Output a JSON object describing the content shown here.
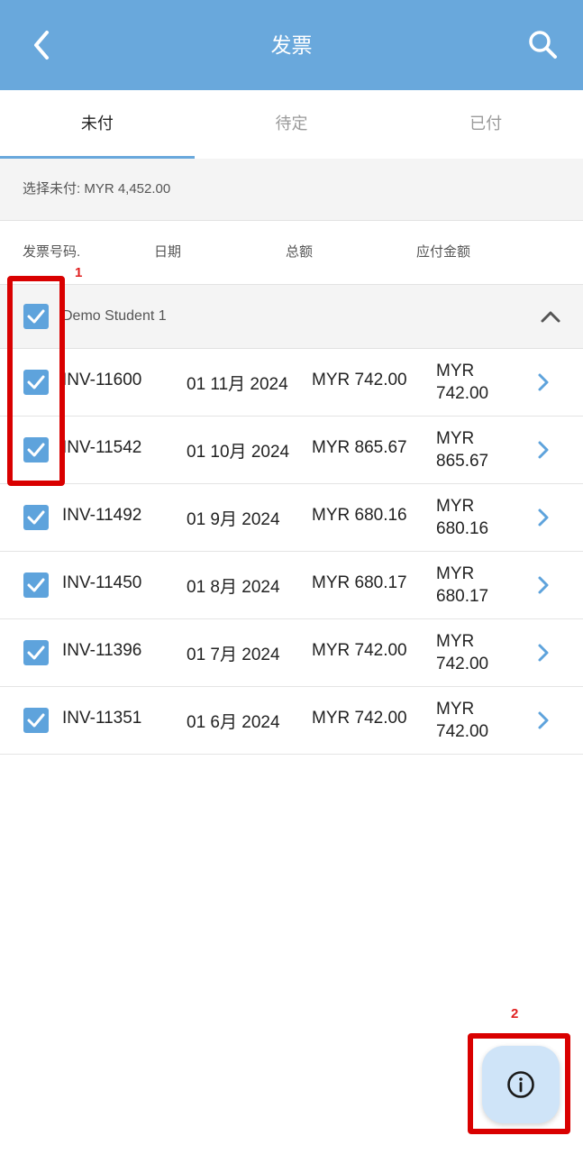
{
  "header": {
    "title": "发票",
    "back_icon": "chevron-left-icon",
    "search_icon": "search-icon"
  },
  "tabs": [
    {
      "label": "未付",
      "active": true
    },
    {
      "label": "待定",
      "active": false
    },
    {
      "label": "已付",
      "active": false
    }
  ],
  "summary": {
    "text": "选择未付: MYR 4,452.00"
  },
  "columns": {
    "invoice_no": "发票号码.",
    "date": "日期",
    "total": "总额",
    "due": "应付金额"
  },
  "group": {
    "label": "Demo Student 1",
    "checked": true,
    "expanded": true
  },
  "invoices": [
    {
      "no": "INV-11600",
      "date": "01 11月 2024",
      "total": "MYR 742.00",
      "due": "MYR 742.00",
      "checked": true
    },
    {
      "no": "INV-11542",
      "date": "01 10月 2024",
      "total": "MYR 865.67",
      "due": "MYR 865.67",
      "checked": true
    },
    {
      "no": "INV-11492",
      "date": "01 9月 2024",
      "total": "MYR 680.16",
      "due": "MYR 680.16",
      "checked": true
    },
    {
      "no": "INV-11450",
      "date": "01 8月 2024",
      "total": "MYR 680.17",
      "due": "MYR 680.17",
      "checked": true
    },
    {
      "no": "INV-11396",
      "date": "01 7月 2024",
      "total": "MYR 742.00",
      "due": "MYR 742.00",
      "checked": true
    },
    {
      "no": "INV-11351",
      "date": "01 6月 2024",
      "total": "MYR 742.00",
      "due": "MYR 742.00",
      "checked": true
    }
  ],
  "annotations": [
    {
      "label": "1"
    },
    {
      "label": "2"
    }
  ],
  "fab": {
    "icon": "info-icon"
  },
  "colors": {
    "header": "#69a8dc",
    "checkbox": "#5ea3dc",
    "chevron": "#5ea3dc",
    "annotation": "#d90000",
    "fab": "#cfe4f8"
  }
}
